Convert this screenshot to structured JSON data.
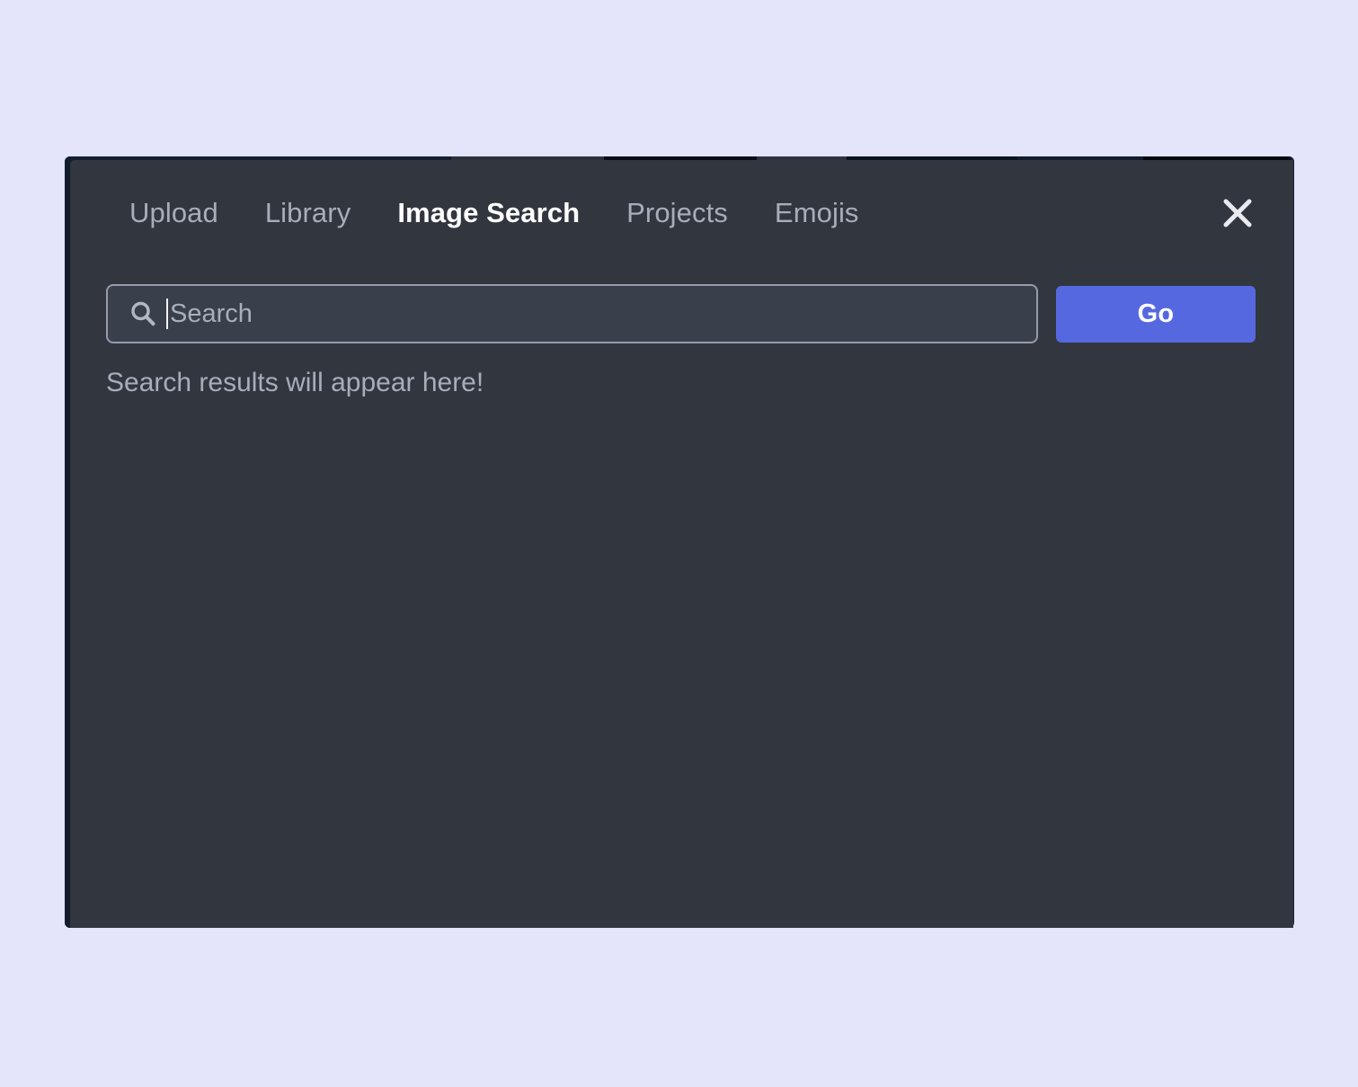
{
  "window": {
    "background_color": "#e4e4fa",
    "modal_background_color": "#32363f"
  },
  "modal": {
    "tabs": [
      {
        "label": "Upload",
        "active": false
      },
      {
        "label": "Library",
        "active": false
      },
      {
        "label": "Image Search",
        "active": true
      },
      {
        "label": "Projects",
        "active": false
      },
      {
        "label": "Emojis",
        "active": false
      }
    ],
    "close_icon": "close-icon",
    "search": {
      "icon": "search-icon",
      "placeholder": "Search",
      "value": "",
      "caret_visible": true,
      "go_label": "Go",
      "go_color": "#5668e0"
    },
    "results": {
      "placeholder": "Search results will appear here!",
      "items": []
    }
  }
}
